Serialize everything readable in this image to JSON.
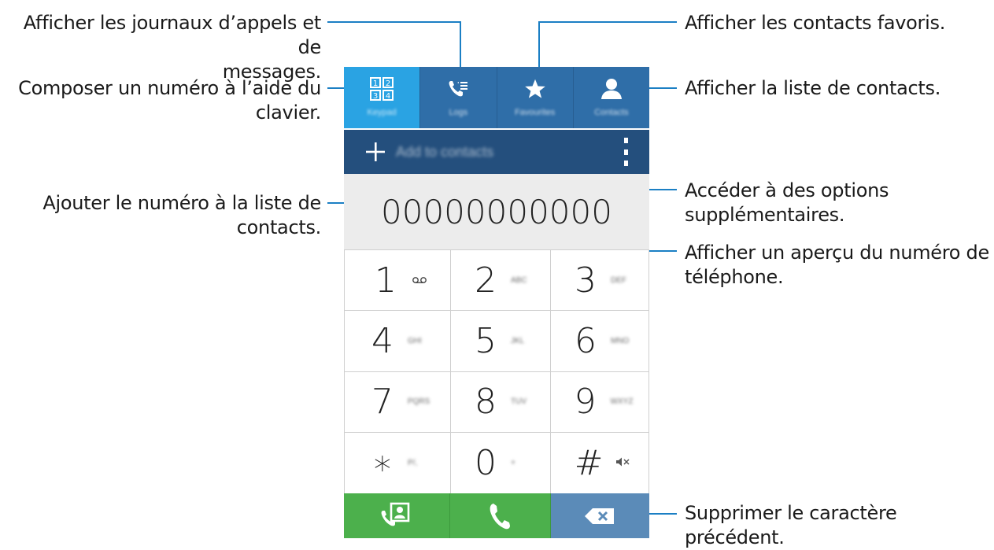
{
  "callouts": {
    "logs": "Afficher les journaux d’appels et de messages.",
    "logs_line1": "Afficher les journaux d’appels et de",
    "logs_line2": "messages.",
    "keypad_line1": "Composer un numéro à l’aide du",
    "keypad_line2": "clavier.",
    "add_line1": "Ajouter le numéro à la liste de",
    "add_line2": "contacts.",
    "favorites": "Afficher les contacts favoris.",
    "contacts": "Afficher la liste de contacts.",
    "options_line1": "Accéder à des options",
    "options_line2": "supplémentaires.",
    "preview_line1": "Afficher un aperçu du numéro de",
    "preview_line2": "téléphone.",
    "delete": "Supprimer le caractère précédent."
  },
  "tabs": [
    {
      "label": "Keypad",
      "icon": "keypad-icon",
      "active": true
    },
    {
      "label": "Logs",
      "icon": "call-log-icon",
      "active": false
    },
    {
      "label": "Favourites",
      "icon": "star-icon",
      "active": false
    },
    {
      "label": "Contacts",
      "icon": "person-icon",
      "active": false
    }
  ],
  "action_bar": {
    "add_label": "Add to contacts",
    "add_icon": "plus-icon",
    "more_icon": "more-vertical-icon"
  },
  "display": {
    "number": "00000000000"
  },
  "keys": [
    {
      "digit": "1",
      "letters": "",
      "glyph": "voicemail-icon"
    },
    {
      "digit": "2",
      "letters": "ABC"
    },
    {
      "digit": "3",
      "letters": "DEF"
    },
    {
      "digit": "4",
      "letters": "GHI"
    },
    {
      "digit": "5",
      "letters": "JKL"
    },
    {
      "digit": "6",
      "letters": "MNO"
    },
    {
      "digit": "7",
      "letters": "PQRS"
    },
    {
      "digit": "8",
      "letters": "TUV"
    },
    {
      "digit": "9",
      "letters": "WXYZ"
    },
    {
      "digit": "∗",
      "letters": "P/,"
    },
    {
      "digit": "0",
      "letters": "+"
    },
    {
      "digit": "#",
      "letters": "",
      "glyph": "mute-icon"
    }
  ],
  "bottom_bar": {
    "video_call_icon": "video-call-icon",
    "call_icon": "phone-icon",
    "delete_icon": "backspace-icon"
  },
  "colors": {
    "tab_bar": "#2f6ea8",
    "tab_active": "#2aa3e3",
    "action_bar": "#244f7d",
    "call_green": "#4cb04c",
    "delete_blue": "#5b8bb8",
    "callout_line": "#1b7fc4"
  }
}
